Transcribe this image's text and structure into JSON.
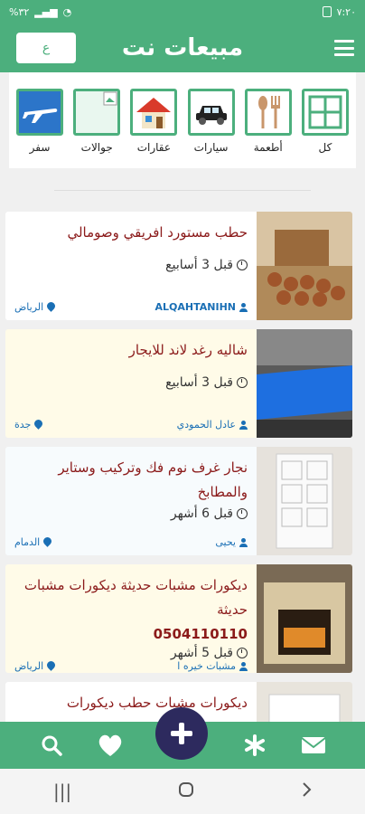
{
  "status_bar": {
    "time": "٧:٢٠",
    "left_text": "%٣٢"
  },
  "app_bar": {
    "title": "مبيعات نت",
    "lang_label": "ع"
  },
  "categories": [
    {
      "label": "كل",
      "icon": "grid-icon"
    },
    {
      "label": "أطعمة",
      "icon": "spoon-fork-icon"
    },
    {
      "label": "سيارات",
      "icon": "car-icon"
    },
    {
      "label": "عقارات",
      "icon": "house-icon"
    },
    {
      "label": "جوالات",
      "icon": "broken-image-icon"
    },
    {
      "label": "سفر",
      "icon": "airplane-icon"
    }
  ],
  "listings": [
    {
      "title": "حطب مستورد افريقي وصومالي",
      "phone": "",
      "time": "قبل 3 أسابيع",
      "user": "ALQAHTANIHN",
      "city": "الرياض",
      "style": "white"
    },
    {
      "title": "شاليه رغد لاند للايجار",
      "phone": "",
      "time": "قبل 3 أسابيع",
      "user": "عادل الحمودي",
      "city": "جدة",
      "style": "cream"
    },
    {
      "title": "نجار غرف نوم فك وتركيب وستاير والمطابخ",
      "phone": "",
      "time": "قبل 6 أشهر",
      "user": "يحيى",
      "city": "الدمام",
      "style": "light"
    },
    {
      "title": "ديكورات مشبات حديثة ديكورات مشبات حديثة",
      "phone": "0504110110",
      "time": "قبل 5 أشهر",
      "user": "مشبات خيره ا",
      "city": "الرياض",
      "style": "cream"
    },
    {
      "title": "ديكورات مشبات حطب ديكورات",
      "phone": "",
      "time": "",
      "user": "",
      "city": "",
      "style": "white"
    }
  ],
  "colors": {
    "primary": "#4caf7d",
    "fab": "#2d2a5e",
    "title": "#8b1a1a",
    "link": "#1a6fb5"
  }
}
